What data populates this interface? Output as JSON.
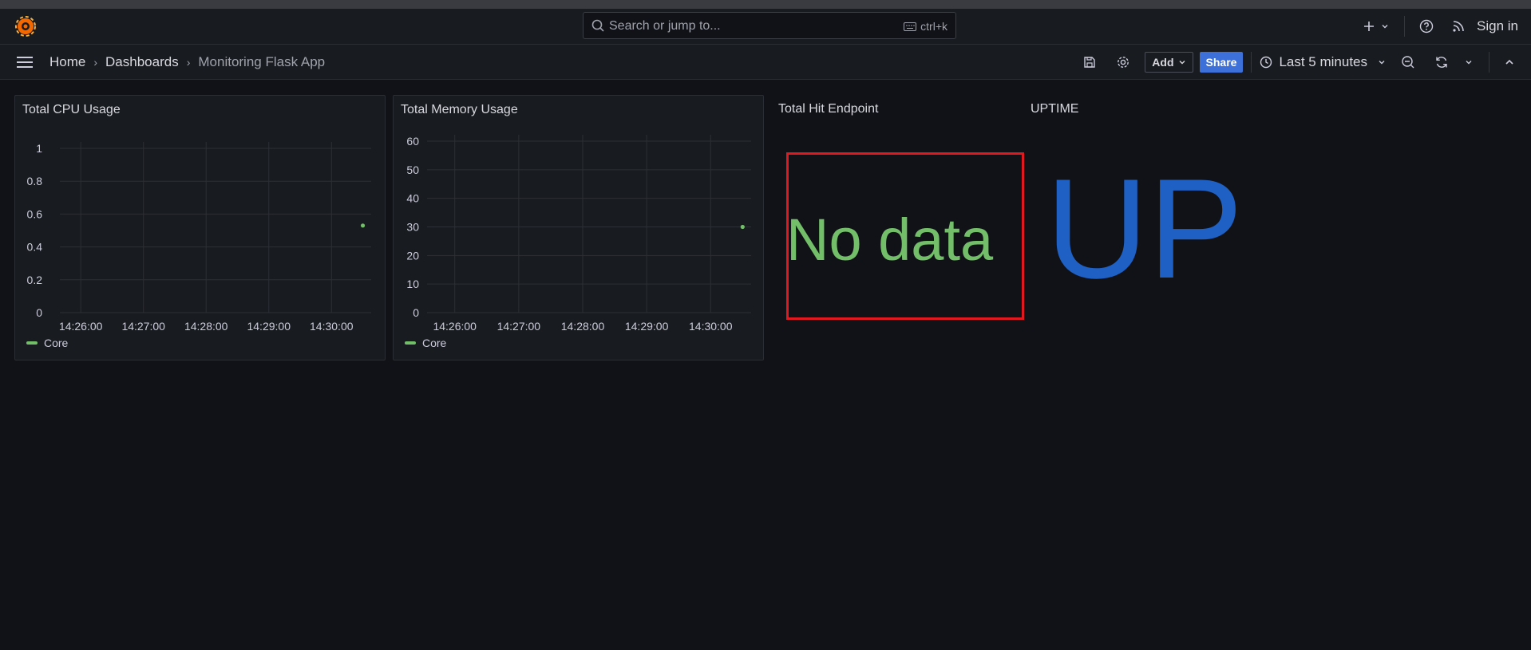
{
  "search": {
    "placeholder": "Search or jump to...",
    "shortcut": "ctrl+k"
  },
  "topbar": {
    "signin_label": "Sign in"
  },
  "breadcrumb": {
    "home": "Home",
    "dashboards": "Dashboards",
    "current": "Monitoring Flask App"
  },
  "toolbar": {
    "add_label": "Add",
    "share_label": "Share",
    "time_range": "Last 5 minutes"
  },
  "colors": {
    "series": "#73bf69",
    "uptime": "#1f60c4",
    "highlight": "#e0181f",
    "share": "#3d71d9"
  },
  "panels": {
    "cpu": {
      "title": "Total CPU Usage",
      "legend": "Core"
    },
    "mem": {
      "title": "Total Memory Usage",
      "legend": "Core"
    },
    "hits": {
      "title": "Total Hit Endpoint",
      "value": "No data"
    },
    "uptime": {
      "title": "UPTIME",
      "value": "UP"
    }
  },
  "chart_data": [
    {
      "type": "line",
      "title": "Total CPU Usage",
      "x_ticks": [
        "14:26:00",
        "14:27:00",
        "14:28:00",
        "14:29:00",
        "14:30:00"
      ],
      "y_ticks": [
        "0",
        "0.2",
        "0.4",
        "0.6",
        "0.8",
        "1"
      ],
      "ylim": [
        0,
        1
      ],
      "grid": true,
      "legend_position": "bottom-left",
      "series": [
        {
          "name": "Core",
          "points": [
            {
              "x": "14:30:30",
              "y": 0.53
            }
          ]
        }
      ]
    },
    {
      "type": "line",
      "title": "Total Memory Usage",
      "x_ticks": [
        "14:26:00",
        "14:27:00",
        "14:28:00",
        "14:29:00",
        "14:30:00"
      ],
      "y_ticks": [
        "0",
        "10",
        "20",
        "30",
        "40",
        "50",
        "60"
      ],
      "ylim": [
        0,
        60
      ],
      "grid": true,
      "legend_position": "bottom-left",
      "series": [
        {
          "name": "Core",
          "points": [
            {
              "x": "14:30:30",
              "y": 30
            }
          ]
        }
      ]
    }
  ]
}
